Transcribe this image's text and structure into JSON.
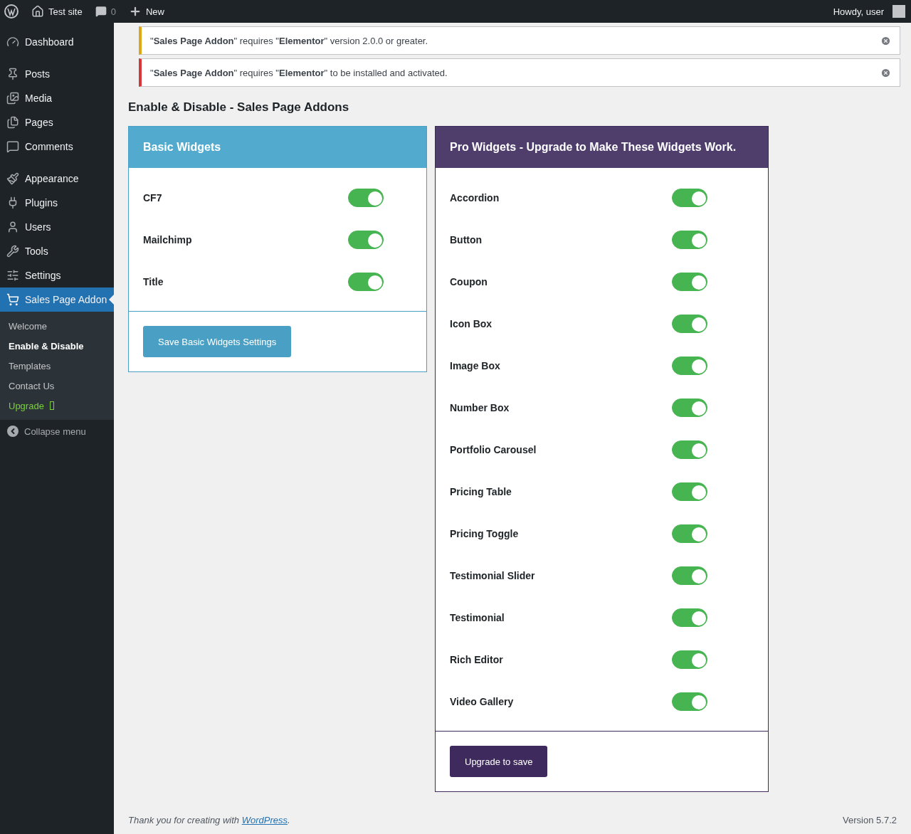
{
  "admin_bar": {
    "site": "Test site",
    "comments": "0",
    "new": "New",
    "greeting": "Howdy, user"
  },
  "sidebar": {
    "groups": [
      [
        {
          "label": "Dashboard",
          "selected": false
        }
      ],
      [
        {
          "label": "Posts",
          "selected": false
        },
        {
          "label": "Media",
          "selected": false
        },
        {
          "label": "Pages",
          "selected": false
        },
        {
          "label": "Comments",
          "selected": false
        }
      ],
      [
        {
          "label": "Appearance",
          "selected": false
        },
        {
          "label": "Plugins",
          "selected": false
        },
        {
          "label": "Users",
          "selected": false
        },
        {
          "label": "Tools",
          "selected": false
        },
        {
          "label": "Settings",
          "selected": false
        },
        {
          "label": "Sales Page Addon",
          "selected": true
        }
      ]
    ],
    "submenu": [
      {
        "label": "Welcome",
        "selected": false,
        "kind": "link"
      },
      {
        "label": "Enable & Disable",
        "selected": true,
        "kind": "link"
      },
      {
        "label": "Templates",
        "selected": false,
        "kind": "link"
      },
      {
        "label": "Contact Us",
        "selected": false,
        "kind": "link"
      },
      {
        "label": "Upgrade",
        "selected": false,
        "kind": "upgrade"
      }
    ],
    "collapse": "Collapse menu"
  },
  "notices": [
    {
      "kind": "warning",
      "text": "\"**Sales Page Addon**\" requires \"**Elementor**\" version 2.0.0 or greater."
    },
    {
      "kind": "error",
      "text": "\"**Sales Page Addon**\" requires \"**Elementor**\" to be installed and activated."
    }
  ],
  "heading": "Enable & Disable - Sales Page Addons",
  "panels": [
    {
      "kind": "basic",
      "title": "Basic Widgets",
      "button": "Save Basic Widgets Settings",
      "widgets": [
        {
          "label": "CF7",
          "on": true
        },
        {
          "label": "Mailchimp",
          "on": true
        },
        {
          "label": "Title",
          "on": true
        }
      ]
    },
    {
      "kind": "pro",
      "title": "Pro Widgets - Upgrade to Make These Widgets Work.",
      "button": "Upgrade to save",
      "widgets": [
        {
          "label": "Accordion",
          "on": true
        },
        {
          "label": "Button",
          "on": true
        },
        {
          "label": "Coupon",
          "on": true
        },
        {
          "label": "Icon Box",
          "on": true
        },
        {
          "label": "Image Box",
          "on": true
        },
        {
          "label": "Number Box",
          "on": true
        },
        {
          "label": "Portfolio Carousel",
          "on": true
        },
        {
          "label": "Pricing Table",
          "on": true
        },
        {
          "label": "Pricing Toggle",
          "on": true
        },
        {
          "label": "Testimonial Slider",
          "on": true
        },
        {
          "label": "Testimonial",
          "on": true
        },
        {
          "label": "Rich Editor",
          "on": true
        },
        {
          "label": "Video Gallery",
          "on": true
        }
      ]
    }
  ],
  "footer": {
    "text": "Thank you for creating with ",
    "link": "WordPress",
    "after": ".",
    "version": "Version 5.7.2"
  }
}
